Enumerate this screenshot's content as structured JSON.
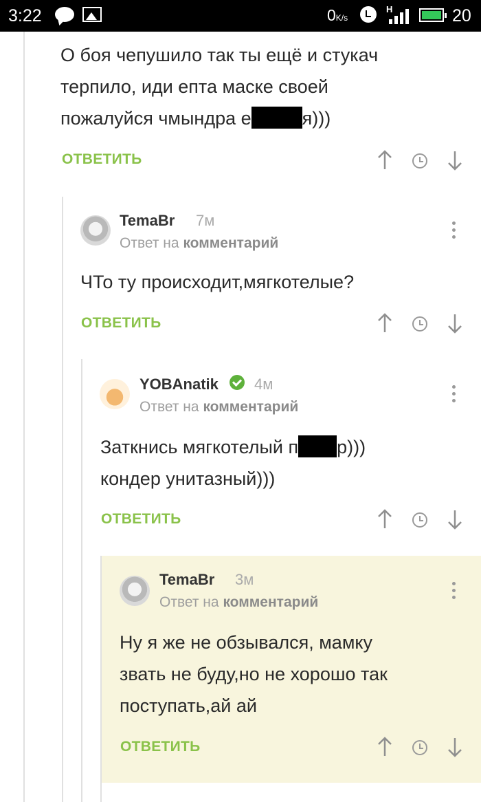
{
  "status_bar": {
    "time": "3:22",
    "speed_value": "0",
    "speed_unit": "K/s",
    "network": "H",
    "battery_level": "20"
  },
  "comments": [
    {
      "text_line1": "О боя чепушило так ты ещё и стукач",
      "text_line2": "терпило, иди епта маске своей",
      "text_line3_pre": "пожалуйся чмындра е",
      "text_line3_post": "я)))",
      "reply": "ОТВЕТИТЬ"
    },
    {
      "author": "TemaBr",
      "time": "7м",
      "reply_to_prefix": "Ответ на",
      "reply_to_link": "комментарий",
      "text": "ЧТо ту происходит,мягкотелые?",
      "reply": "ОТВЕТИТЬ"
    },
    {
      "author": "YOBAnatik",
      "time": "4м",
      "reply_to_prefix": "Ответ на",
      "reply_to_link": "комментарий",
      "text_line1_pre": "Заткнись мягкотелый п",
      "text_line1_post": "р)))",
      "text_line2": "кондер унитазный)))",
      "reply": "ОТВЕТИТЬ"
    },
    {
      "author": "TemaBr",
      "time": "3м",
      "reply_to_prefix": "Ответ на",
      "reply_to_link": "комментарий",
      "text_line1": "Ну я же не обзывался, мамку",
      "text_line2": "звать не буду,но не хорошо так",
      "text_line3": "поступать,ай ай",
      "reply": "ОТВЕТИТЬ"
    }
  ],
  "colors": {
    "accent": "#8ac24a",
    "highlight_bg": "#f8f5dd",
    "verified": "#5eb13b"
  }
}
